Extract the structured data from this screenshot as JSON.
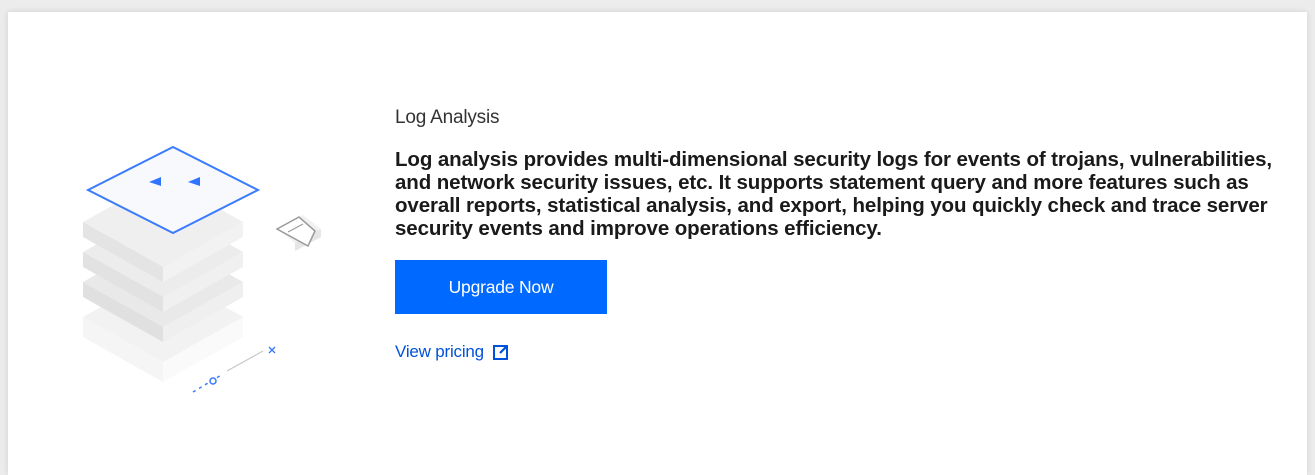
{
  "promo": {
    "title": "Log Analysis",
    "description": "Log analysis provides multi-dimensional security logs for events of trojans, vulnerabilities, and network security issues, etc. It supports statement query and more features such as overall reports, statistical analysis, and export, helping you quickly check and trace server security events and improve operations efficiency.",
    "upgrade_label": "Upgrade Now",
    "pricing_label": "View pricing",
    "pricing_icon": "external-link-icon"
  },
  "colors": {
    "primary": "#0069ff",
    "link": "#0052d9",
    "title": "#333333",
    "text": "#1a1a1a",
    "background": "#ffffff"
  }
}
